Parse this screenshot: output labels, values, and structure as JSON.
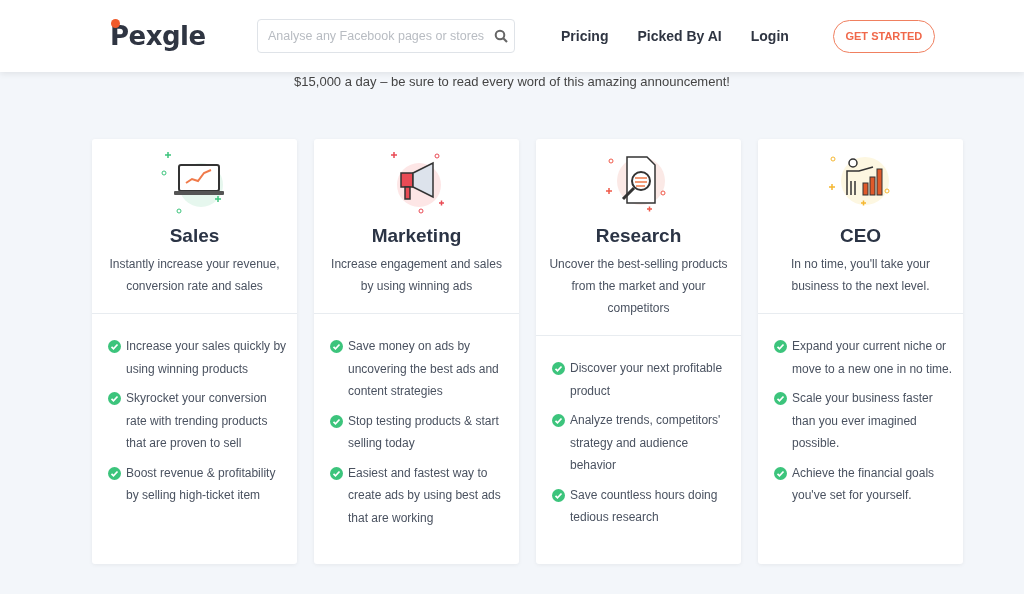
{
  "header": {
    "logo": "Pexgle",
    "search": {
      "placeholder": "Analyse any Facebook pages or stores"
    },
    "nav": [
      "Pricing",
      "Picked By AI",
      "Login"
    ],
    "cta": "GET STARTED"
  },
  "teaser": "$15,000 a day – be sure to read every word of this amazing announcement!",
  "cards": [
    {
      "title": "Sales",
      "description": "Instantly increase your revenue, conversion rate and sales",
      "features": [
        "Increase your sales quickly by using winning products",
        "Skyrocket your conversion rate with trending products that are proven to sell",
        "Boost revenue & profitability by selling high-ticket item"
      ]
    },
    {
      "title": "Marketing",
      "description": "Increase engagement and sales by using winning ads",
      "features": [
        "Save money on ads by uncovering the best ads and content strategies",
        "Stop testing products & start selling today",
        "Easiest and fastest way to create ads by using best ads that are working"
      ]
    },
    {
      "title": "Research",
      "description": "Uncover the best-selling products from the market and your competitors",
      "features": [
        "Discover your next profitable product",
        "Analyze trends, competitors' strategy and audience behavior",
        "Save countless hours doing tedious research"
      ]
    },
    {
      "title": "CEO",
      "description": "In no time, you'll take your business to the next level.",
      "features": [
        "Expand your current niche or move to a new one in no time.",
        "Scale your business faster than you ever imagined possible.",
        "Achieve the financial goals you've set for yourself."
      ]
    }
  ]
}
